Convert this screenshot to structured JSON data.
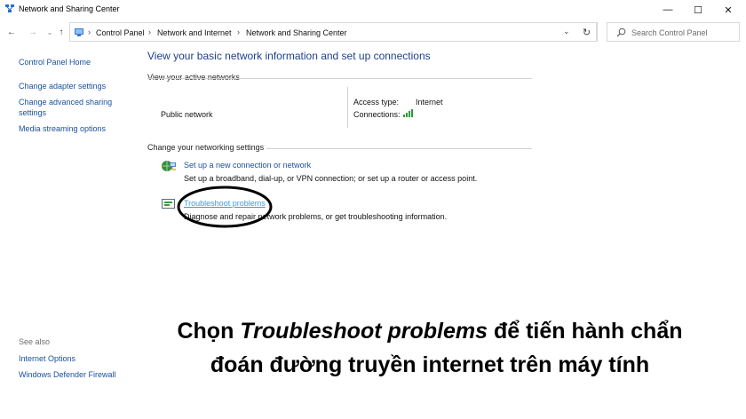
{
  "window": {
    "title": "Network and Sharing Center",
    "minimize_glyph": "—",
    "maximize_glyph": "☐",
    "close_glyph": "✕"
  },
  "nav": {
    "back_glyph": "←",
    "forward_glyph": "→",
    "recent_glyph": "⌄",
    "up_glyph": "↑",
    "breadcrumbs": [
      "Control Panel",
      "Network and Internet",
      "Network and Sharing Center"
    ],
    "separator": "›",
    "dropdown_glyph": "⌄",
    "refresh_glyph": "↻",
    "search_placeholder": "Search Control Panel"
  },
  "left_pane": {
    "links": [
      "Control Panel Home",
      "Change adapter settings",
      "Change advanced sharing settings",
      "Media streaming options"
    ],
    "see_also_label": "See also",
    "see_also_links": [
      "Internet Options",
      "Windows Defender Firewall"
    ]
  },
  "main": {
    "title": "View your basic network information and set up connections",
    "active_networks_label": "View your active networks",
    "network_name": "Public network",
    "access_type_label": "Access type:",
    "access_type_value": "Internet",
    "connections_label": "Connections:",
    "change_settings_label": "Change your networking settings",
    "tasks": [
      {
        "link": "Set up a new connection or network",
        "desc": "Set up a broadband, dial-up, or VPN connection; or set up a router or access point.",
        "icon": "network-setup-icon"
      },
      {
        "link": "Troubleshoot problems",
        "desc": "Diagnose and repair network problems, or get troubleshooting information.",
        "icon": "troubleshoot-icon"
      }
    ]
  },
  "caption": {
    "line1_before": "Chọn ",
    "line1_italic": "Troubleshoot problems",
    "line1_after": " để tiến hành chẩn",
    "line2": "đoán đường truyền internet trên máy tính"
  },
  "colors": {
    "link": "#1a4f9c",
    "title": "#1e3f8f",
    "visited_link": "#3e9bd6",
    "signal": "#2e9a3a"
  }
}
